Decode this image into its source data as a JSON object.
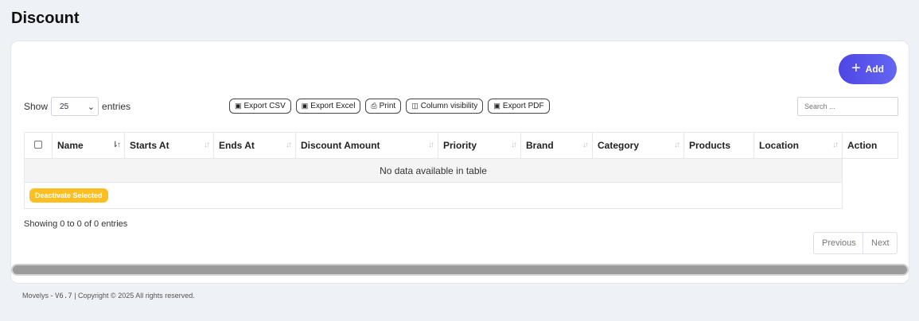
{
  "page": {
    "title": "Discount"
  },
  "toolbar": {
    "add_label": "Add",
    "show_label": "Show",
    "entries_label": "entries",
    "page_length": "25",
    "search_placeholder": "Search ...",
    "exports": [
      {
        "label": "Export CSV",
        "icon": "file-csv-icon"
      },
      {
        "label": "Export Excel",
        "icon": "file-excel-icon"
      },
      {
        "label": "Print",
        "icon": "print-icon"
      },
      {
        "label": "Column visibility",
        "icon": "columns-icon"
      },
      {
        "label": "Export PDF",
        "icon": "file-pdf-icon"
      }
    ]
  },
  "table": {
    "columns": [
      "Name",
      "Starts At",
      "Ends At",
      "Discount Amount",
      "Priority",
      "Brand",
      "Category",
      "Products",
      "Location",
      "Action"
    ],
    "empty_message": "No data available in table",
    "bulk_action_label": "Deactivate Selected"
  },
  "pagination": {
    "info": "Showing 0 to 0 of 0 entries",
    "previous": "Previous",
    "next": "Next"
  },
  "footer": {
    "brand": "Movelys - ",
    "version": "V6.7",
    "copyright": " | Copyright © 2025 All rights reserved."
  },
  "colors": {
    "accent": "#4f46e5",
    "warning": "#fbbf24",
    "background": "#eef1f6"
  }
}
